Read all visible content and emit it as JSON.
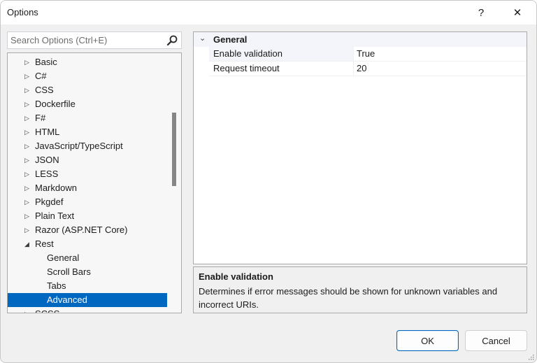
{
  "window": {
    "title": "Options",
    "help_label": "?",
    "close_label": "✕"
  },
  "search": {
    "placeholder": "Search Options (Ctrl+E)",
    "value": ""
  },
  "tree": {
    "items": [
      {
        "label": "Basic",
        "expanded": false
      },
      {
        "label": "C#",
        "expanded": false
      },
      {
        "label": "CSS",
        "expanded": false
      },
      {
        "label": "Dockerfile",
        "expanded": false
      },
      {
        "label": "F#",
        "expanded": false
      },
      {
        "label": "HTML",
        "expanded": false
      },
      {
        "label": "JavaScript/TypeScript",
        "expanded": false
      },
      {
        "label": "JSON",
        "expanded": false
      },
      {
        "label": "LESS",
        "expanded": false
      },
      {
        "label": "Markdown",
        "expanded": false
      },
      {
        "label": "Pkgdef",
        "expanded": false
      },
      {
        "label": "Plain Text",
        "expanded": false
      },
      {
        "label": "Razor (ASP.NET Core)",
        "expanded": false
      },
      {
        "label": "Rest",
        "expanded": true
      },
      {
        "label": "General",
        "child": true
      },
      {
        "label": "Scroll Bars",
        "child": true
      },
      {
        "label": "Tabs",
        "child": true
      },
      {
        "label": "Advanced",
        "child": true,
        "selected": true
      },
      {
        "label": "SCSS",
        "expanded": false
      }
    ],
    "collapsed_glyph": "▷",
    "expanded_glyph": "◢",
    "selected_color": "#0067c0"
  },
  "property_grid": {
    "category": "General",
    "category_glyph": "⌄",
    "properties": [
      {
        "name": "Enable validation",
        "value": "True"
      },
      {
        "name": "Request timeout",
        "value": "20"
      }
    ]
  },
  "description": {
    "title": "Enable validation",
    "text": "Determines if error messages should be shown for unknown variables and incorrect URIs."
  },
  "buttons": {
    "ok": "OK",
    "cancel": "Cancel"
  }
}
